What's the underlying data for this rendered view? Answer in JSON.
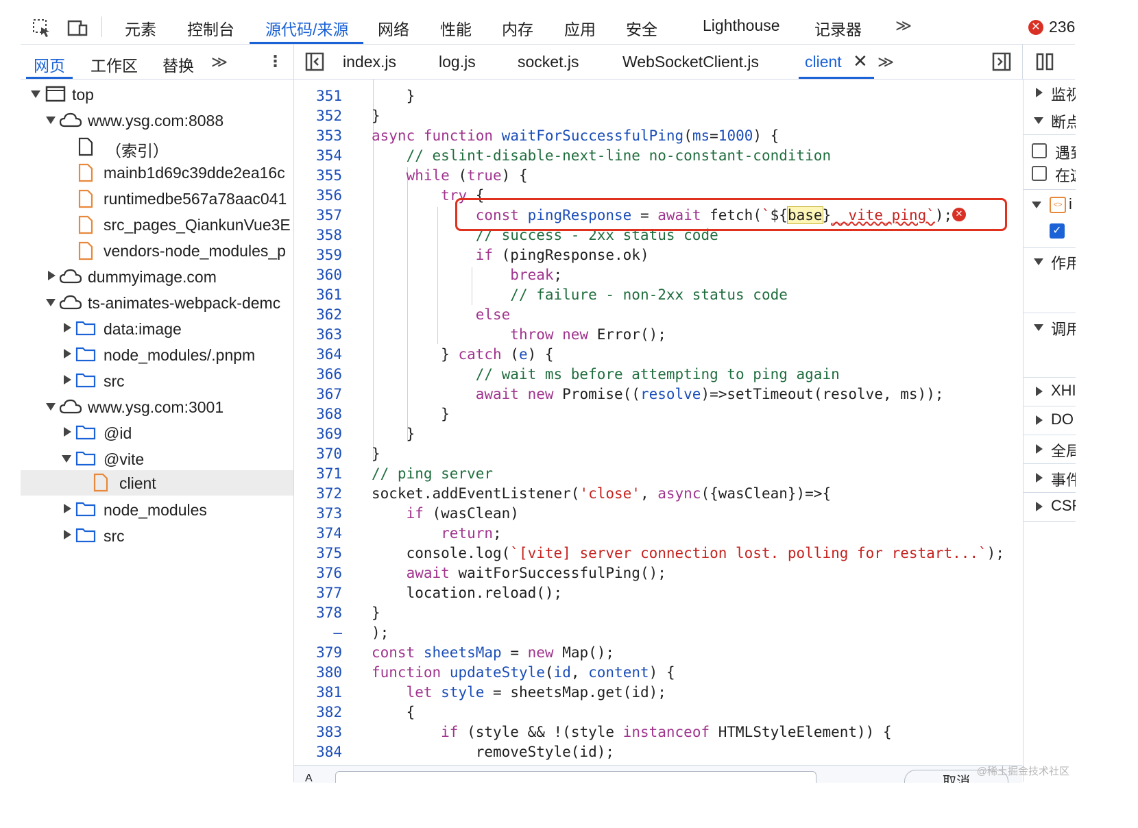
{
  "toolbar": {
    "tabs": [
      "元素",
      "控制台",
      "源代码/来源",
      "网络",
      "性能",
      "内存",
      "应用",
      "安全",
      "Lighthouse",
      "记录器"
    ],
    "more": "≫",
    "error_count": "236"
  },
  "navigator": {
    "tabs": [
      "网页",
      "工作区",
      "替换"
    ],
    "more": "≫",
    "menu": "⋮"
  },
  "file_tabs": [
    "index.js",
    "log.js",
    "socket.js",
    "WebSocketClient.js",
    "client"
  ],
  "file_tabs_more": "≫",
  "tree": [
    {
      "label": "top"
    },
    {
      "label": "www.ysg.com:8088"
    },
    {
      "label": "（索引）"
    },
    {
      "label": "mainb1d69c39dde2ea16c"
    },
    {
      "label": "runtimedbe567a78aac041"
    },
    {
      "label": "src_pages_QiankunVue3E"
    },
    {
      "label": "vendors-node_modules_p"
    },
    {
      "label": "dummyimage.com"
    },
    {
      "label": "ts-animates-webpack-demc"
    },
    {
      "label": "data:image"
    },
    {
      "label": "node_modules/.pnpm"
    },
    {
      "label": "src"
    },
    {
      "label": "www.ysg.com:3001"
    },
    {
      "label": "@id"
    },
    {
      "label": "@vite"
    },
    {
      "label": "client"
    },
    {
      "label": "node_modules"
    },
    {
      "label": "src"
    }
  ],
  "code_lines": [
    {
      "n": "351"
    },
    {
      "n": "352"
    },
    {
      "n": "353"
    },
    {
      "n": "354"
    },
    {
      "n": "355"
    },
    {
      "n": "356"
    },
    {
      "n": "357"
    },
    {
      "n": "358"
    },
    {
      "n": "359"
    },
    {
      "n": "360"
    },
    {
      "n": "361"
    },
    {
      "n": "362"
    },
    {
      "n": "363"
    },
    {
      "n": "364"
    },
    {
      "n": "366"
    },
    {
      "n": "367"
    },
    {
      "n": "368"
    },
    {
      "n": "369"
    },
    {
      "n": "370"
    },
    {
      "n": "371"
    },
    {
      "n": "372"
    },
    {
      "n": "373"
    },
    {
      "n": "374"
    },
    {
      "n": "375"
    },
    {
      "n": "376"
    },
    {
      "n": "377"
    },
    {
      "n": "378"
    },
    {
      "n": "–"
    },
    {
      "n": "379"
    },
    {
      "n": "380"
    },
    {
      "n": "381"
    },
    {
      "n": "382"
    },
    {
      "n": "383"
    },
    {
      "n": "384"
    }
  ],
  "right_panel": [
    {
      "label": "监视"
    },
    {
      "label": "断点"
    },
    {
      "label": "遇到"
    },
    {
      "label": "在这"
    },
    {
      "label": "i"
    },
    {
      "label": "作用"
    },
    {
      "label": "调用"
    },
    {
      "label": "XHI"
    },
    {
      "label": "DO"
    },
    {
      "label": "全局"
    },
    {
      "label": "事件"
    },
    {
      "label": "CSF"
    }
  ],
  "bottom_bar": {
    "text": "取消"
  },
  "watermark": "@稀土掘金技术社区",
  "colors": {
    "accent": "#1a62d6",
    "error": "#d93025",
    "highlight_box": "#e0301e"
  }
}
